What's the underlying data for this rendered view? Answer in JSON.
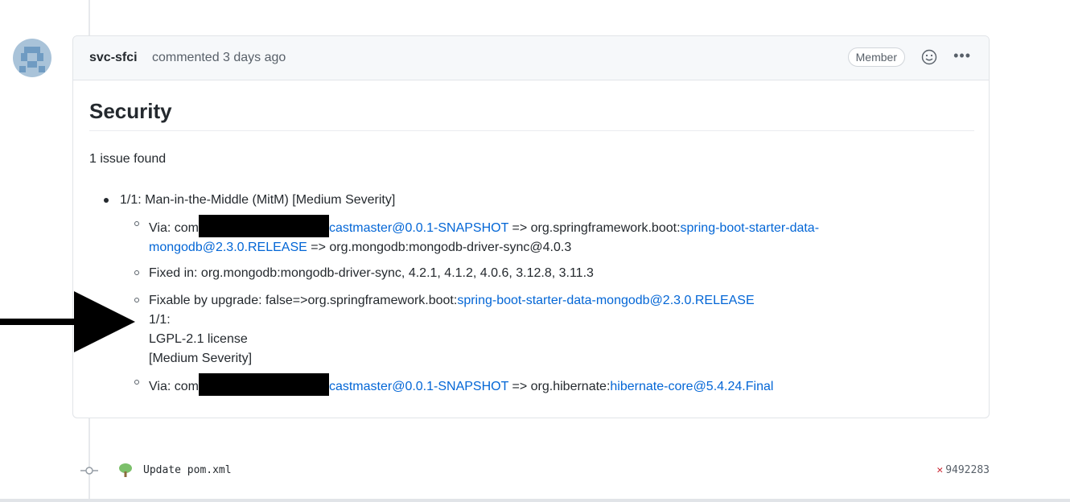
{
  "comment": {
    "author": "svc-sfci",
    "meta": "commented 3 days ago",
    "badge": "Member",
    "icons": {
      "reaction": "smiley-icon",
      "more": "ellipsis-icon"
    }
  },
  "body": {
    "heading": "Security",
    "summary": "1 issue found",
    "issue": "1/1: Man-in-the-Middle (MitM) [Medium Severity]",
    "via1_prefix": "Via: com",
    "via1_link1": "castmaster@0.0.1-SNAPSHOT",
    "via1_mid": " => org.springframework.boot:",
    "via1_link2": "spring-boot-starter-data-mongodb@2.3.0.RELEASE",
    "via1_suffix": " => org.mongodb:mongodb-driver-sync@4.0.3",
    "fixed_in": "Fixed in: org.mongodb:mongodb-driver-sync, 4.2.1, 4.1.2, 4.0.6, 3.12.8, 3.11.3",
    "fixable_prefix": "Fixable by upgrade: false=>org.springframework.boot:",
    "fixable_link": "spring-boot-starter-data-mongodb@2.3.0.RELEASE",
    "license_line1": "1/1:",
    "license_line2": "LGPL-2.1 license",
    "license_line3": "[Medium Severity]",
    "via2_prefix": "Via: com",
    "via2_link1": "castmaster@0.0.1-SNAPSHOT",
    "via2_mid": " => org.hibernate:",
    "via2_link2": "hibernate-core@5.4.24.Final"
  },
  "commit": {
    "message": "Update pom.xml",
    "sha": "9492283",
    "status": "failed"
  },
  "colors": {
    "link": "#0366d6",
    "fail": "#cb2431"
  }
}
